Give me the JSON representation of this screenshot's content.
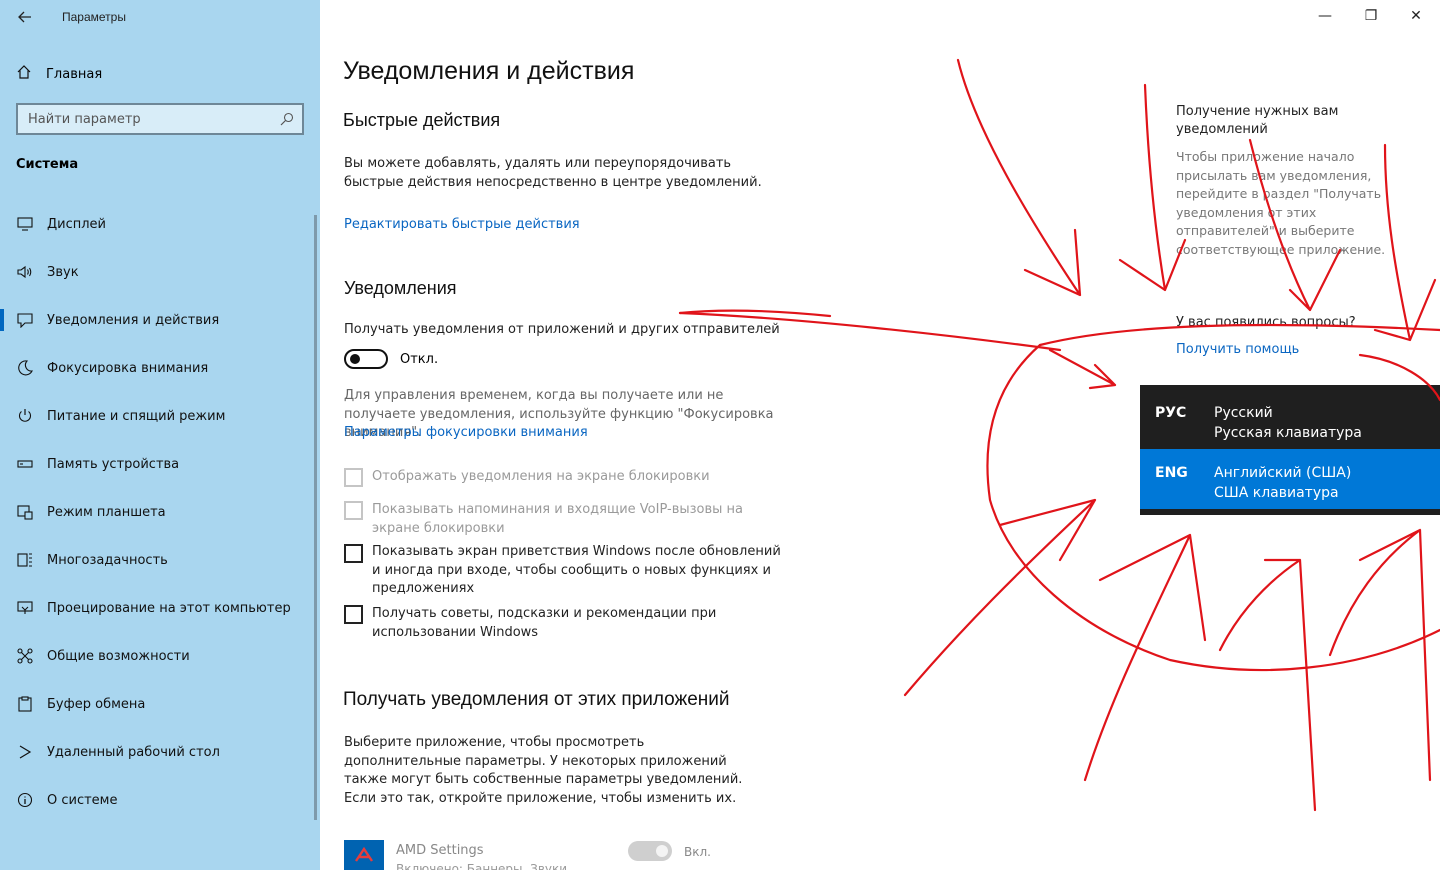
{
  "window": {
    "title": "Параметры",
    "controls": {
      "minimize": "—",
      "restore": "❐",
      "close": "✕"
    }
  },
  "sidebar": {
    "home_label": "Главная",
    "search_placeholder": "Найти параметр",
    "section_title": "Система",
    "items": [
      {
        "label": "Дисплей",
        "icon": "display-icon"
      },
      {
        "label": "Звук",
        "icon": "sound-icon"
      },
      {
        "label": "Уведомления и действия",
        "icon": "notifications-icon",
        "active": true
      },
      {
        "label": "Фокусировка внимания",
        "icon": "moon-icon"
      },
      {
        "label": "Питание и спящий режим",
        "icon": "power-icon"
      },
      {
        "label": "Память устройства",
        "icon": "storage-icon"
      },
      {
        "label": "Режим планшета",
        "icon": "tablet-icon"
      },
      {
        "label": "Многозадачность",
        "icon": "multitasking-icon"
      },
      {
        "label": "Проецирование на этот компьютер",
        "icon": "projection-icon"
      },
      {
        "label": "Общие возможности",
        "icon": "shared-icon"
      },
      {
        "label": "Буфер обмена",
        "icon": "clipboard-icon"
      },
      {
        "label": "Удаленный рабочий стол",
        "icon": "remote-desktop-icon"
      },
      {
        "label": "О системе",
        "icon": "info-icon"
      }
    ]
  },
  "main": {
    "page_title": "Уведомления и действия",
    "quick_actions": {
      "heading": "Быстрые действия",
      "description": "Вы можете добавлять, удалять или переупорядочивать быстрые действия непосредственно в центре уведомлений.",
      "edit_link": "Редактировать быстрые действия"
    },
    "notifications": {
      "heading": "Уведомления",
      "toggle_caption": "Получать уведомления от приложений и других отправителей",
      "toggle_state": "Откл.",
      "focus_text": "Для управления временем, когда вы получаете или не получаете уведомления, используйте функцию \"Фокусировка внимания\".",
      "focus_link": "Параметры фокусировки внимания",
      "checkboxes": [
        {
          "label": "Отображать уведомления на экране блокировки",
          "disabled": true
        },
        {
          "label": "Показывать напоминания и входящие VoIP-вызовы на экране блокировки",
          "disabled": true
        },
        {
          "label": "Показывать экран приветствия Windows после обновлений и иногда при входе, чтобы сообщить о новых функциях и предложениях",
          "disabled": false
        },
        {
          "label": "Получать советы, подсказки и рекомендации при использовании Windows",
          "disabled": false
        }
      ]
    },
    "apps": {
      "heading": "Получать уведомления от этих приложений",
      "description": "Выберите приложение, чтобы просмотреть дополнительные параметры. У некоторых приложений также могут быть собственные параметры уведомлений. Если это так, откройте приложение, чтобы изменить их.",
      "items": [
        {
          "name": "AMD Settings",
          "sub": "Включено: Баннеры, Звуки",
          "toggle_state": "Вкл."
        }
      ]
    }
  },
  "help": {
    "title": "Получение нужных вам уведомлений",
    "body": "Чтобы приложение начало присылать вам уведомления, перейдите в раздел \"Получать уведомления от этих отправителей\" и выберите соответствующее приложение.",
    "question": "У вас появились вопросы?",
    "help_link": "Получить помощь"
  },
  "language_flyout": {
    "items": [
      {
        "code": "РУС",
        "name": "Русский",
        "keyboard": "Русская клавиатура",
        "selected": false
      },
      {
        "code": "ENG",
        "name": "Английский (США)",
        "keyboard": "США клавиатура",
        "selected": true
      }
    ]
  },
  "colors": {
    "sidebar_bg": "#a9d6ef",
    "accent": "#0078d7",
    "link": "#0a66c2",
    "annotation_red": "#e0141a"
  }
}
